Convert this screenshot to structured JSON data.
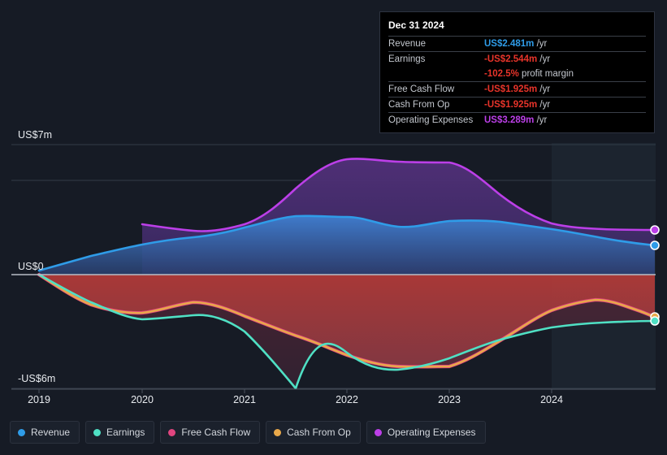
{
  "chart_data": {
    "type": "area",
    "title": "",
    "xlabel": "",
    "ylabel": "",
    "grid": true,
    "legend_position": "bottom",
    "y_ticks": [
      "US$7m",
      "US$0",
      "-US$6m"
    ],
    "ylim": [
      -6,
      7
    ],
    "x_ticks": [
      "2019",
      "2020",
      "2021",
      "2022",
      "2023",
      "2024"
    ],
    "xlim": [
      2019,
      2025
    ],
    "forecast_start": "2024",
    "x": [
      2019,
      2019.5,
      2020,
      2020.5,
      2021,
      2021.5,
      2022,
      2022.5,
      2023,
      2023.5,
      2024,
      2024.5,
      2025
    ],
    "series": [
      {
        "name": "Revenue",
        "color": "#2f9ce8",
        "values": [
          0.0,
          0.55,
          1.0,
          1.35,
          1.7,
          2.55,
          3.1,
          2.8,
          3.05,
          3.0,
          2.85,
          2.65,
          2.481
        ]
      },
      {
        "name": "Earnings",
        "color": "#4fe0c4",
        "values": [
          0.0,
          -1.6,
          -2.3,
          -1.8,
          -2.7,
          -6.1,
          -4.2,
          -3.15,
          -3.1,
          -2.6,
          -2.0,
          -1.85,
          -1.75
        ]
      },
      {
        "name": "Free Cash Flow",
        "color": "#e0457f",
        "values": [
          0.0,
          -1.1,
          -1.85,
          -1.3,
          -1.75,
          -2.0,
          -2.45,
          -3.15,
          -3.1,
          -2.2,
          -1.35,
          -1.1,
          -1.925
        ]
      },
      {
        "name": "Cash From Op",
        "color": "#e8a84a",
        "values": [
          0.0,
          -1.1,
          -1.85,
          -1.3,
          -1.75,
          -2.0,
          -2.45,
          -3.15,
          -3.1,
          -2.2,
          -1.35,
          -1.1,
          -1.925
        ]
      },
      {
        "name": "Operating Expenses",
        "color": "#bc3fe8",
        "values": [
          null,
          null,
          2.75,
          2.6,
          2.85,
          4.5,
          6.2,
          6.05,
          6.0,
          4.7,
          3.6,
          3.35,
          3.289
        ]
      }
    ]
  },
  "tooltip": {
    "title": "Dec 31 2024",
    "rows": [
      {
        "key": "Revenue",
        "value": "US$2.481m",
        "unit": "/yr",
        "color": "#2f9ce8"
      },
      {
        "key": "Earnings",
        "value": "-US$2.544m",
        "unit": "/yr",
        "color": "#e8342a"
      },
      {
        "key": "",
        "value": "-102.5%",
        "unit": "profit margin",
        "color": "#e8342a"
      },
      {
        "key": "Free Cash Flow",
        "value": "-US$1.925m",
        "unit": "/yr",
        "color": "#e8342a"
      },
      {
        "key": "Cash From Op",
        "value": "-US$1.925m",
        "unit": "/yr",
        "color": "#e8342a"
      },
      {
        "key": "Operating Expenses",
        "value": "US$3.289m",
        "unit": "/yr",
        "color": "#bc3fe8"
      }
    ]
  },
  "legend": {
    "items": [
      {
        "label": "Revenue",
        "color": "#2f9ce8"
      },
      {
        "label": "Earnings",
        "color": "#4fe0c4"
      },
      {
        "label": "Free Cash Flow",
        "color": "#e0457f"
      },
      {
        "label": "Cash From Op",
        "color": "#e8a84a"
      },
      {
        "label": "Operating Expenses",
        "color": "#bc3fe8"
      }
    ]
  },
  "axes": {
    "y": [
      {
        "label": "US$7m",
        "class": "y-label-top"
      },
      {
        "label": "US$0",
        "class": "y-label-zero"
      },
      {
        "label": "-US$6m",
        "class": "y-label-bot"
      }
    ],
    "x": [
      "2019",
      "2020",
      "2021",
      "2022",
      "2023",
      "2024"
    ]
  }
}
